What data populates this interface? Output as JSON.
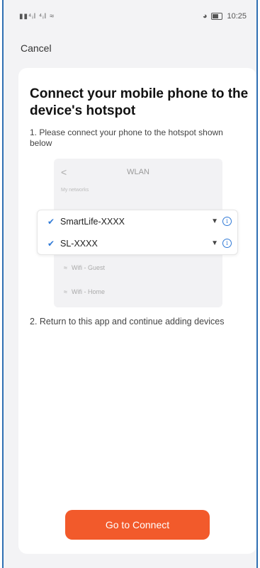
{
  "status_bar": {
    "time": "10:25",
    "signal_text": "▮▮⁴ᵢl ⁴ᵢl",
    "icons": [
      "signal-icon",
      "wifi-icon",
      "alarm-icon",
      "battery-icon"
    ]
  },
  "nav": {
    "cancel_label": "Cancel"
  },
  "card": {
    "title": "Connect your mobile phone to the device's hotspot",
    "step1": "1. Please connect your phone to the hotspot shown below",
    "step2": "2. Return to this app and continue adding devices"
  },
  "wlan_mock": {
    "title": "WLAN",
    "section_label": "My networks",
    "networks": [
      {
        "name": "SmartLife-XXXX",
        "checked": true
      },
      {
        "name": "SL-XXXX",
        "checked": true
      }
    ],
    "other_networks": [
      {
        "name": "Wifi - Guest"
      },
      {
        "name": "Wifi - Home"
      }
    ]
  },
  "actions": {
    "connect_label": "Go to Connect"
  },
  "colors": {
    "accent": "#f25a2b",
    "check": "#2f79d6"
  }
}
